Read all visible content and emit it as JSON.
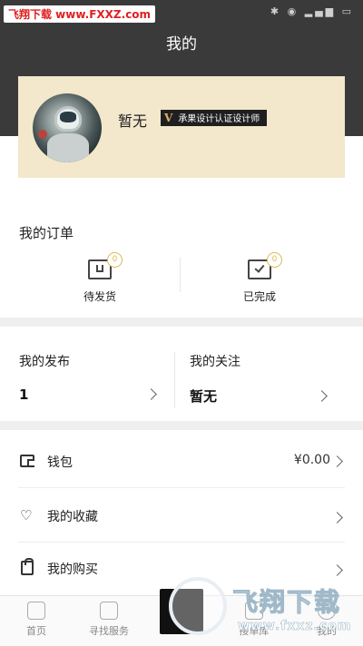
{
  "watermark": {
    "text": "飞翔下载 www.FXXZ.com"
  },
  "header": {
    "title": "我的"
  },
  "profile": {
    "name": "暂无",
    "badge_mark": "V",
    "badge_text": "承果设计认证设计师"
  },
  "orders": {
    "title": "我的订单",
    "items": [
      {
        "label": "待发货",
        "count": "0"
      },
      {
        "label": "已完成",
        "count": "0"
      }
    ]
  },
  "stats": {
    "publish": {
      "title": "我的发布",
      "value": "1"
    },
    "follow": {
      "title": "我的关注",
      "value": "暂无"
    }
  },
  "menu": [
    {
      "label": "钱包",
      "value": "¥0.00",
      "icon": "wallet-icon"
    },
    {
      "label": "我的收藏",
      "value": "",
      "icon": "heart-icon"
    },
    {
      "label": "我的购买",
      "value": "",
      "icon": "bag-icon"
    }
  ],
  "tabbar": {
    "items": [
      {
        "label": "首页"
      },
      {
        "label": "寻找服务"
      },
      {
        "label": ""
      },
      {
        "label": "接单库"
      },
      {
        "label": "我的"
      }
    ]
  },
  "overlay": {
    "brand": "飞翔下载",
    "url": "www.fxxz.com"
  },
  "colors": {
    "header": "#3a3a3a",
    "card": "#f3e7cc",
    "accent": "#e2b85b",
    "badge": "#1f1f1f"
  }
}
